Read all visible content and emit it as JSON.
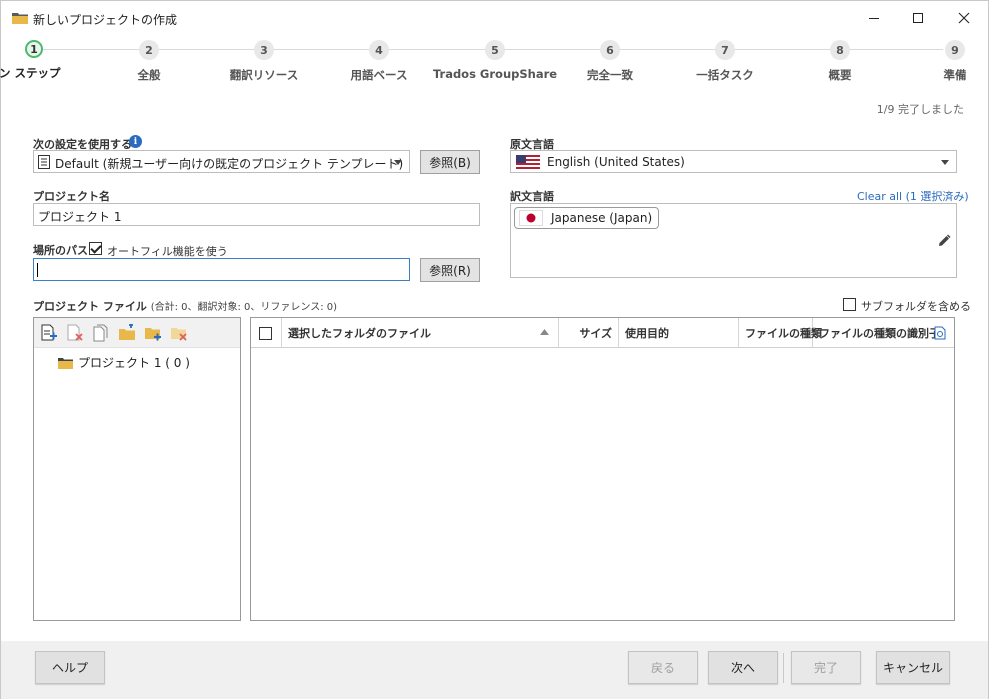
{
  "window": {
    "title": "新しいプロジェクトの作成",
    "icon": "folder-icon"
  },
  "stepper": {
    "current_step": 1,
    "steps": [
      {
        "number": "1",
        "label": "ワン ステップ"
      },
      {
        "number": "2",
        "label": "全般"
      },
      {
        "number": "3",
        "label": "翻訳リソース"
      },
      {
        "number": "4",
        "label": "用語ベース"
      },
      {
        "number": "5",
        "label": "Trados GroupShare"
      },
      {
        "number": "6",
        "label": "完全一致"
      },
      {
        "number": "7",
        "label": "一括タスク"
      },
      {
        "number": "8",
        "label": "概要"
      },
      {
        "number": "9",
        "label": "準備"
      }
    ],
    "progress_text": "1/9 完了しました"
  },
  "settings": {
    "template_label": "次の設定を使用する",
    "template_value": "Default (新規ユーザー向けの既定のプロジェクト テンプレート)",
    "browse_label": "参照(B)"
  },
  "project": {
    "name_label": "プロジェクト名",
    "name_value": "プロジェクト 1",
    "location_label": "場所のパス",
    "autofill_label": "オートフィル機能を使う",
    "autofill_checked": true,
    "location_value": "",
    "browse_label": "参照(R)"
  },
  "languages": {
    "source_label": "原文言語",
    "source_value": "English (United States)",
    "target_label": "訳文言語",
    "clear_all_label": "Clear all (1 選択済み)",
    "targets": [
      "Japanese (Japan)"
    ]
  },
  "files": {
    "section_label": "プロジェクト ファイル",
    "section_counts": "(合計: 0、翻訳対象: 0、リファレンス: 0)",
    "include_subfolders_label": "サブフォルダを含める",
    "include_subfolders_checked": false,
    "tree_root": "プロジェクト 1 ( 0 )",
    "columns": {
      "files": "選択したフォルダのファイル",
      "size": "サイズ",
      "usage": "使用目的",
      "filetype": "ファイルの種類",
      "filetype_id": "ファイルの種類の識別子"
    },
    "rows": []
  },
  "footer": {
    "help": "ヘルプ",
    "back": "戻る",
    "next": "次へ",
    "finish": "完了",
    "cancel": "キャンセル"
  }
}
